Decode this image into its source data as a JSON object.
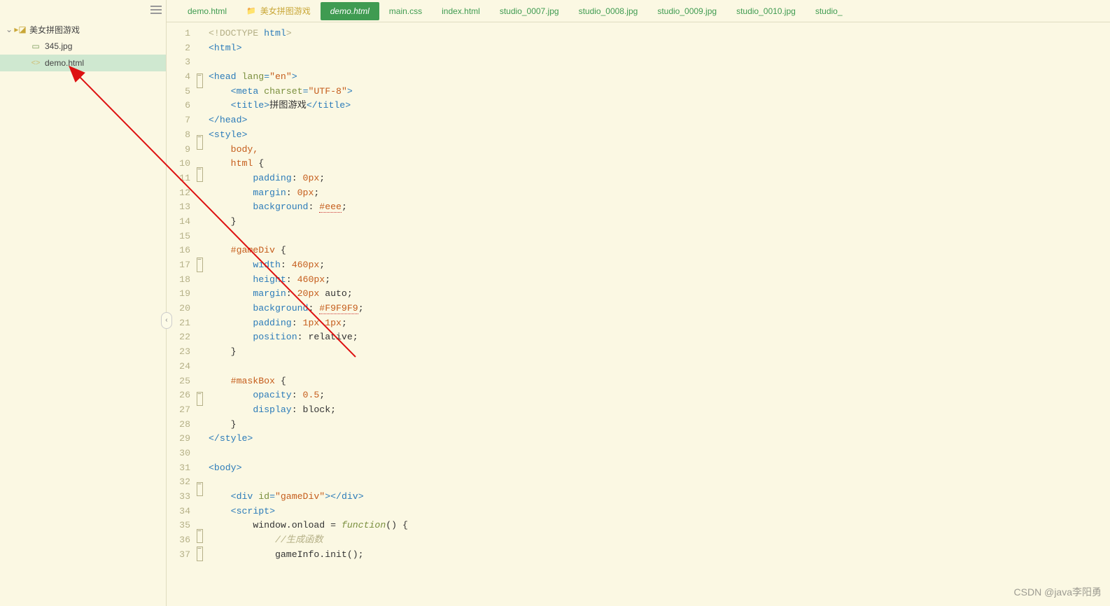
{
  "sidebar": {
    "root": {
      "name": "美女拼图游戏"
    },
    "files": [
      {
        "name": "345.jpg",
        "icon": "image"
      },
      {
        "name": "demo.html",
        "icon": "code",
        "selected": true
      }
    ]
  },
  "tabs": [
    {
      "label": "demo.html",
      "kind": "file"
    },
    {
      "label": "美女拼图游戏",
      "kind": "folder"
    },
    {
      "label": "demo.html",
      "kind": "file",
      "active": true
    },
    {
      "label": "main.css",
      "kind": "file"
    },
    {
      "label": "index.html",
      "kind": "file"
    },
    {
      "label": "studio_0007.jpg",
      "kind": "file"
    },
    {
      "label": "studio_0008.jpg",
      "kind": "file"
    },
    {
      "label": "studio_0009.jpg",
      "kind": "file"
    },
    {
      "label": "studio_0010.jpg",
      "kind": "file"
    },
    {
      "label": "studio_",
      "kind": "file"
    }
  ],
  "code": {
    "start_line": 1,
    "fold_lines": [
      4,
      8,
      10,
      16,
      25,
      31,
      34,
      35
    ],
    "lines": [
      [
        [
          "<!DOCTYPE ",
          "doc"
        ],
        [
          "html",
          "tag"
        ],
        [
          ">",
          "doc"
        ]
      ],
      [
        [
          "<",
          "tag"
        ],
        [
          "html",
          "tag"
        ],
        [
          ">",
          "tag"
        ]
      ],
      [],
      [
        [
          "<",
          "tag"
        ],
        [
          "head ",
          "tag"
        ],
        [
          "lang",
          "attr"
        ],
        [
          "=",
          "tag"
        ],
        [
          "\"en\"",
          "str"
        ],
        [
          ">",
          "tag"
        ]
      ],
      [
        [
          "    ",
          ""
        ],
        [
          "<",
          "tag"
        ],
        [
          "meta ",
          "tag"
        ],
        [
          "charset",
          "attr"
        ],
        [
          "=",
          "tag"
        ],
        [
          "\"UTF-8\"",
          "str"
        ],
        [
          ">",
          "tag"
        ]
      ],
      [
        [
          "    ",
          ""
        ],
        [
          "<",
          "tag"
        ],
        [
          "title",
          "tag"
        ],
        [
          ">",
          "tag"
        ],
        [
          "拼图游戏",
          "text"
        ],
        [
          "</",
          "tag"
        ],
        [
          "title",
          "tag"
        ],
        [
          ">",
          "tag"
        ]
      ],
      [
        [
          "</",
          "tag"
        ],
        [
          "head",
          "tag"
        ],
        [
          ">",
          "tag"
        ]
      ],
      [
        [
          "<",
          "tag"
        ],
        [
          "style",
          "tag"
        ],
        [
          ">",
          "tag"
        ]
      ],
      [
        [
          "    ",
          ""
        ],
        [
          "body,",
          "sel"
        ]
      ],
      [
        [
          "    ",
          ""
        ],
        [
          "html ",
          "sel"
        ],
        [
          "{",
          "text"
        ]
      ],
      [
        [
          "        ",
          ""
        ],
        [
          "padding",
          "prop"
        ],
        [
          ": ",
          "text"
        ],
        [
          "0",
          "num"
        ],
        [
          "px",
          "num"
        ],
        [
          ";",
          "text"
        ]
      ],
      [
        [
          "        ",
          ""
        ],
        [
          "margin",
          "prop"
        ],
        [
          ": ",
          "text"
        ],
        [
          "0",
          "num"
        ],
        [
          "px",
          "num"
        ],
        [
          ";",
          "text"
        ]
      ],
      [
        [
          "        ",
          ""
        ],
        [
          "background",
          "prop"
        ],
        [
          ": ",
          "text"
        ],
        [
          "#eee",
          "num-err"
        ],
        [
          ";",
          "text"
        ]
      ],
      [
        [
          "    }",
          "text"
        ]
      ],
      [],
      [
        [
          "    ",
          ""
        ],
        [
          "#gameDiv ",
          "sel"
        ],
        [
          "{",
          "text"
        ]
      ],
      [
        [
          "        ",
          ""
        ],
        [
          "width",
          "prop"
        ],
        [
          ": ",
          "text"
        ],
        [
          "460",
          "num"
        ],
        [
          "px",
          "num"
        ],
        [
          ";",
          "text"
        ]
      ],
      [
        [
          "        ",
          ""
        ],
        [
          "height",
          "prop"
        ],
        [
          ": ",
          "text"
        ],
        [
          "460",
          "num"
        ],
        [
          "px",
          "num"
        ],
        [
          ";",
          "text"
        ]
      ],
      [
        [
          "        ",
          ""
        ],
        [
          "margin",
          "prop"
        ],
        [
          ": ",
          "text"
        ],
        [
          "20",
          "num"
        ],
        [
          "px",
          "num"
        ],
        [
          " auto;",
          "text"
        ]
      ],
      [
        [
          "        ",
          ""
        ],
        [
          "background",
          "prop"
        ],
        [
          ": ",
          "text"
        ],
        [
          "#F9F9F9",
          "num-err"
        ],
        [
          ";",
          "text"
        ]
      ],
      [
        [
          "        ",
          ""
        ],
        [
          "padding",
          "prop"
        ],
        [
          ": ",
          "text"
        ],
        [
          "1",
          "num"
        ],
        [
          "px ",
          "num"
        ],
        [
          "1",
          "num"
        ],
        [
          "px",
          "num"
        ],
        [
          ";",
          "text"
        ]
      ],
      [
        [
          "        ",
          ""
        ],
        [
          "position",
          "prop"
        ],
        [
          ": relative;",
          "text"
        ]
      ],
      [
        [
          "    }",
          "text"
        ]
      ],
      [],
      [
        [
          "    ",
          ""
        ],
        [
          "#maskBox ",
          "sel"
        ],
        [
          "{",
          "text"
        ]
      ],
      [
        [
          "        ",
          ""
        ],
        [
          "opacity",
          "prop"
        ],
        [
          ": ",
          "text"
        ],
        [
          "0.5",
          "num"
        ],
        [
          ";",
          "text"
        ]
      ],
      [
        [
          "        ",
          ""
        ],
        [
          "display",
          "prop"
        ],
        [
          ": block;",
          "text"
        ]
      ],
      [
        [
          "    }",
          "text"
        ]
      ],
      [
        [
          "</",
          "tag"
        ],
        [
          "style",
          "tag"
        ],
        [
          ">",
          "tag"
        ]
      ],
      [],
      [
        [
          "<",
          "tag"
        ],
        [
          "body",
          "tag"
        ],
        [
          ">",
          "tag"
        ]
      ],
      [],
      [
        [
          "    ",
          ""
        ],
        [
          "<",
          "tag"
        ],
        [
          "div ",
          "tag"
        ],
        [
          "id",
          "attr"
        ],
        [
          "=",
          "tag"
        ],
        [
          "\"gameDiv\"",
          "str"
        ],
        [
          "></",
          "tag"
        ],
        [
          "div",
          "tag"
        ],
        [
          ">",
          "tag"
        ]
      ],
      [
        [
          "    ",
          ""
        ],
        [
          "<",
          "tag"
        ],
        [
          "script",
          "tag"
        ],
        [
          ">",
          "tag"
        ]
      ],
      [
        [
          "        ",
          ""
        ],
        [
          "window.onload = ",
          "text"
        ],
        [
          "function",
          "func"
        ],
        [
          "() {",
          "text"
        ]
      ],
      [
        [
          "            ",
          ""
        ],
        [
          "//生成函数",
          "cmt"
        ]
      ],
      [
        [
          "            ",
          ""
        ],
        [
          "gameInfo.init();",
          "text"
        ]
      ]
    ]
  },
  "watermark": "CSDN @java李阳勇"
}
